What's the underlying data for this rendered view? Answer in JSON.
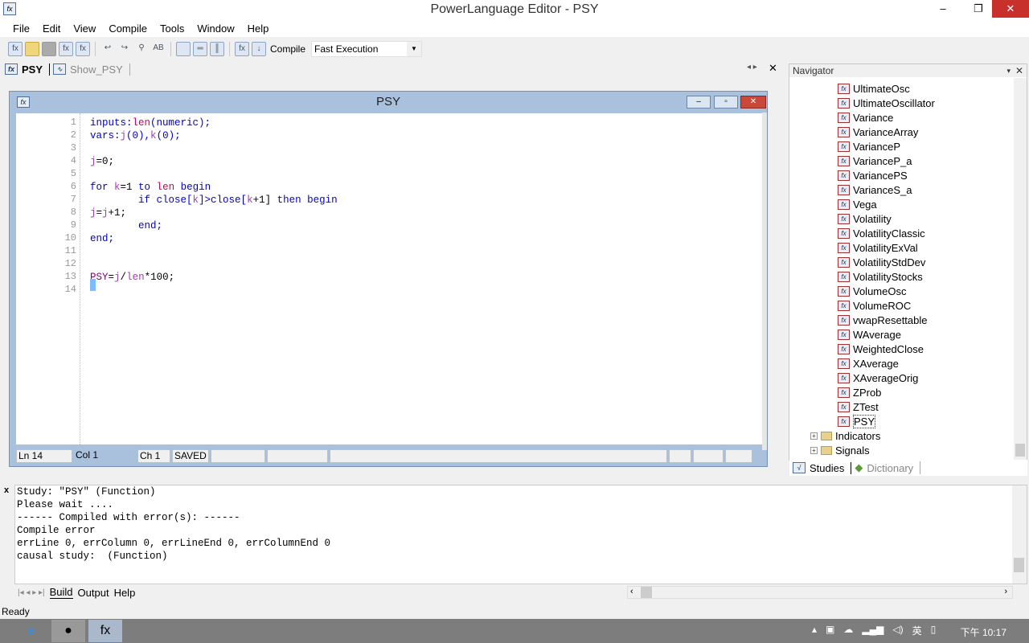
{
  "window": {
    "title": "PowerLanguage Editor - PSY",
    "app_icon": "fx-icon"
  },
  "menu": [
    "File",
    "Edit",
    "View",
    "Compile",
    "Tools",
    "Window",
    "Help"
  ],
  "toolbar": {
    "compile_label": "Compile",
    "execution_mode": "Fast Execution"
  },
  "doc_tabs": [
    {
      "label": "PSY",
      "active": true
    },
    {
      "label": "Show_PSY",
      "active": false
    }
  ],
  "editor": {
    "title": "PSY",
    "lines": [
      [
        [
          "inputs:",
          "kw"
        ],
        [
          "len",
          "inp"
        ],
        [
          "(numeric);",
          "kw"
        ]
      ],
      [
        [
          "vars:",
          "kw"
        ],
        [
          "j",
          "vr"
        ],
        [
          "(0),",
          "kw"
        ],
        [
          "k",
          "vr"
        ],
        [
          "(0);",
          "kw"
        ]
      ],
      [],
      [
        [
          "j",
          "vr"
        ],
        [
          "=0;",
          "op"
        ]
      ],
      [],
      [
        [
          "for ",
          "kw"
        ],
        [
          "k",
          "vr"
        ],
        [
          "=1 ",
          "op"
        ],
        [
          "to ",
          "kw"
        ],
        [
          "len ",
          "inp"
        ],
        [
          "begin",
          "kw"
        ]
      ],
      [
        [
          "        if close[",
          "kw"
        ],
        [
          "k",
          "vr"
        ],
        [
          "]>close[",
          "kw"
        ],
        [
          "k",
          "vr"
        ],
        [
          "+1] ",
          "op"
        ],
        [
          "then begin",
          "kw"
        ]
      ],
      [
        [
          "j",
          "vr"
        ],
        [
          "=",
          "op"
        ],
        [
          "j",
          "vr"
        ],
        [
          "+1;",
          "op"
        ]
      ],
      [
        [
          "        end;",
          "kw"
        ]
      ],
      [
        [
          "end;",
          "kw"
        ]
      ],
      [],
      [],
      [
        [
          "PSY",
          "fn"
        ],
        [
          "=",
          "op"
        ],
        [
          "j",
          "vr"
        ],
        [
          "/",
          "op"
        ],
        [
          "len",
          "vr"
        ],
        [
          "*100;",
          "op"
        ]
      ],
      []
    ],
    "status": {
      "line": "Ln 14",
      "col": "Col 1",
      "ch": "Ch 1",
      "state": "SAVED"
    }
  },
  "navigator": {
    "title": "Navigator",
    "functions": [
      "UltimateOsc",
      "UltimateOscillator",
      "Variance",
      "VarianceArray",
      "VarianceP",
      "VarianceP_a",
      "VariancePS",
      "VarianceS_a",
      "Vega",
      "Volatility",
      "VolatilityClassic",
      "VolatilityExVal",
      "VolatilityStdDev",
      "VolatilityStocks",
      "VolumeOsc",
      "VolumeROC",
      "vwapResettable",
      "WAverage",
      "WeightedClose",
      "XAverage",
      "XAverageOrig",
      "ZProb",
      "ZTest",
      "PSY"
    ],
    "selected": "PSY",
    "folders": [
      "Indicators",
      "Signals"
    ],
    "tabs": [
      "Studies",
      "Dictionary"
    ]
  },
  "output": {
    "lines": [
      "Study: \"PSY\" (Function)",
      "Please wait ....",
      "------ Compiled with error(s): ------",
      "Compile error",
      "errLine 0, errColumn 0, errLineEnd 0, errColumnEnd 0",
      "causal study:  (Function)"
    ],
    "tabs": [
      "Build",
      "Output",
      "Help"
    ],
    "active_tab": "Build"
  },
  "statusbar": "Ready",
  "taskbar": {
    "clock": "下午 10:17",
    "ime": "英",
    "apps": [
      "internet-explorer-icon",
      "chrome-icon",
      "powerlanguage-icon"
    ]
  }
}
